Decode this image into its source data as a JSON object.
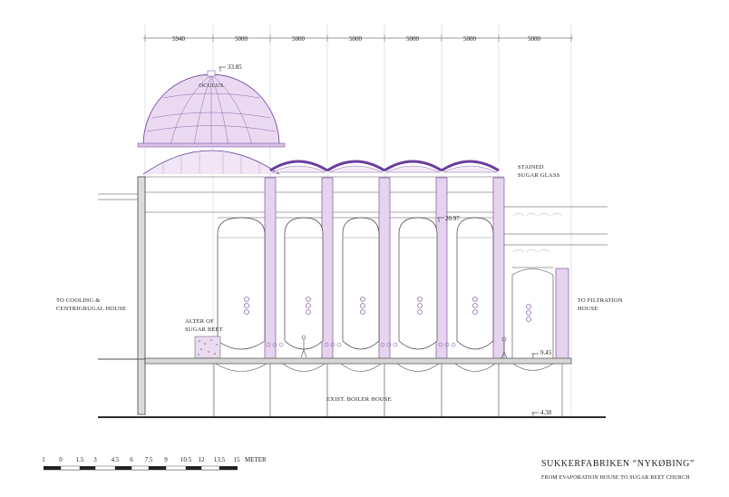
{
  "dimensions": [
    "5940",
    "5000",
    "5000",
    "5000",
    "5000",
    "5000",
    "5000"
  ],
  "levels": {
    "top": "33.85",
    "mid": "20.97",
    "floor": "9.45",
    "ground": "4.30"
  },
  "labels": {
    "oculus": "OCULUS",
    "stained_line1": "STAINED",
    "stained_line2": "SUGAR GLASS",
    "cooling_line1": "TO COOLING &",
    "cooling_line2": "CENTRIGRUGAL HOUSE",
    "altar_line1": "ALTER OF",
    "altar_line2": "SUGAR BEET",
    "filtration_line1": "TO FILTRATION",
    "filtration_line2": "HOUSE",
    "boiler": "EXIST. BOILER HOUSE"
  },
  "scale_bar": {
    "ticks": [
      "1",
      "0",
      "1.5",
      "3",
      "4.5",
      "6",
      "7.5",
      "9",
      "10.5",
      "12",
      "13.5",
      "15"
    ],
    "unit": "METER"
  },
  "title": "SUKKERFABRIKEN “NYKØBING”",
  "subtitle": "FROM EVAPORATION HOUSE TO SUGAR BEET CHURCH",
  "colors": {
    "accent": "#6a3d9a",
    "accent_fill": "#e6d3ee",
    "line": "#333333"
  }
}
